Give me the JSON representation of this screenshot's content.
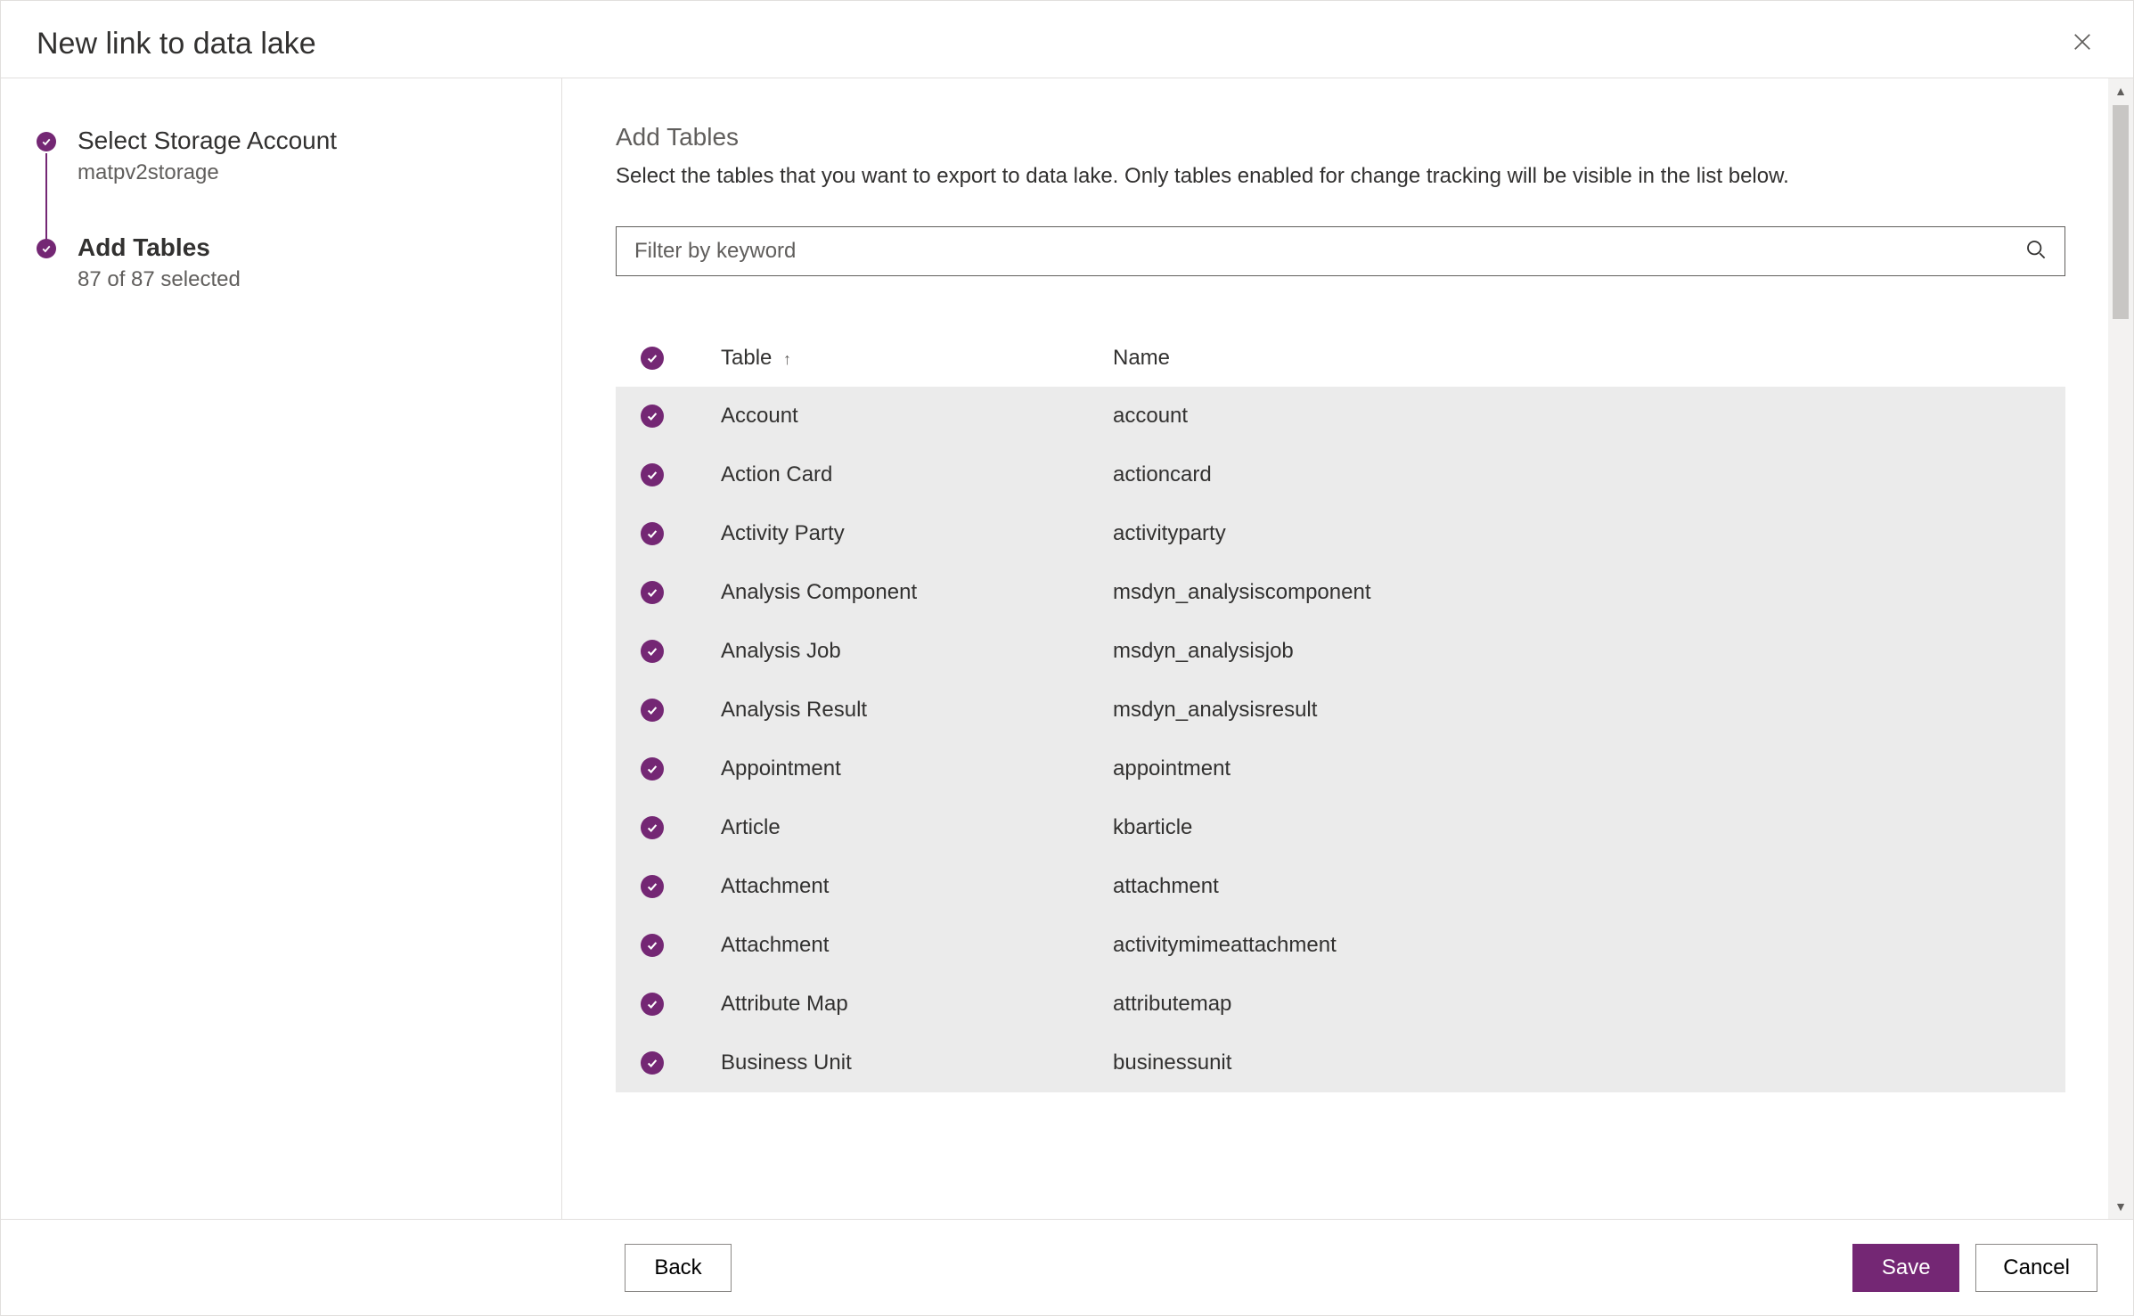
{
  "header": {
    "title": "New link to data lake"
  },
  "steps": {
    "storage": {
      "title": "Select Storage Account",
      "sub": "matpv2storage"
    },
    "tables": {
      "title": "Add Tables",
      "sub": "87 of 87 selected"
    }
  },
  "panel": {
    "title": "Add Tables",
    "description": "Select the tables that you want to export to data lake. Only tables enabled for change tracking will be visible in the list below.",
    "search_placeholder": "Filter by keyword"
  },
  "columns": {
    "table": "Table",
    "name": "Name"
  },
  "rows": [
    {
      "table": "Account",
      "name": "account"
    },
    {
      "table": "Action Card",
      "name": "actioncard"
    },
    {
      "table": "Activity Party",
      "name": "activityparty"
    },
    {
      "table": "Analysis Component",
      "name": "msdyn_analysiscomponent"
    },
    {
      "table": "Analysis Job",
      "name": "msdyn_analysisjob"
    },
    {
      "table": "Analysis Result",
      "name": "msdyn_analysisresult"
    },
    {
      "table": "Appointment",
      "name": "appointment"
    },
    {
      "table": "Article",
      "name": "kbarticle"
    },
    {
      "table": "Attachment",
      "name": "attachment"
    },
    {
      "table": "Attachment",
      "name": "activitymimeattachment"
    },
    {
      "table": "Attribute Map",
      "name": "attributemap"
    },
    {
      "table": "Business Unit",
      "name": "businessunit"
    }
  ],
  "footer": {
    "back": "Back",
    "save": "Save",
    "cancel": "Cancel"
  },
  "colors": {
    "accent": "#742774"
  }
}
